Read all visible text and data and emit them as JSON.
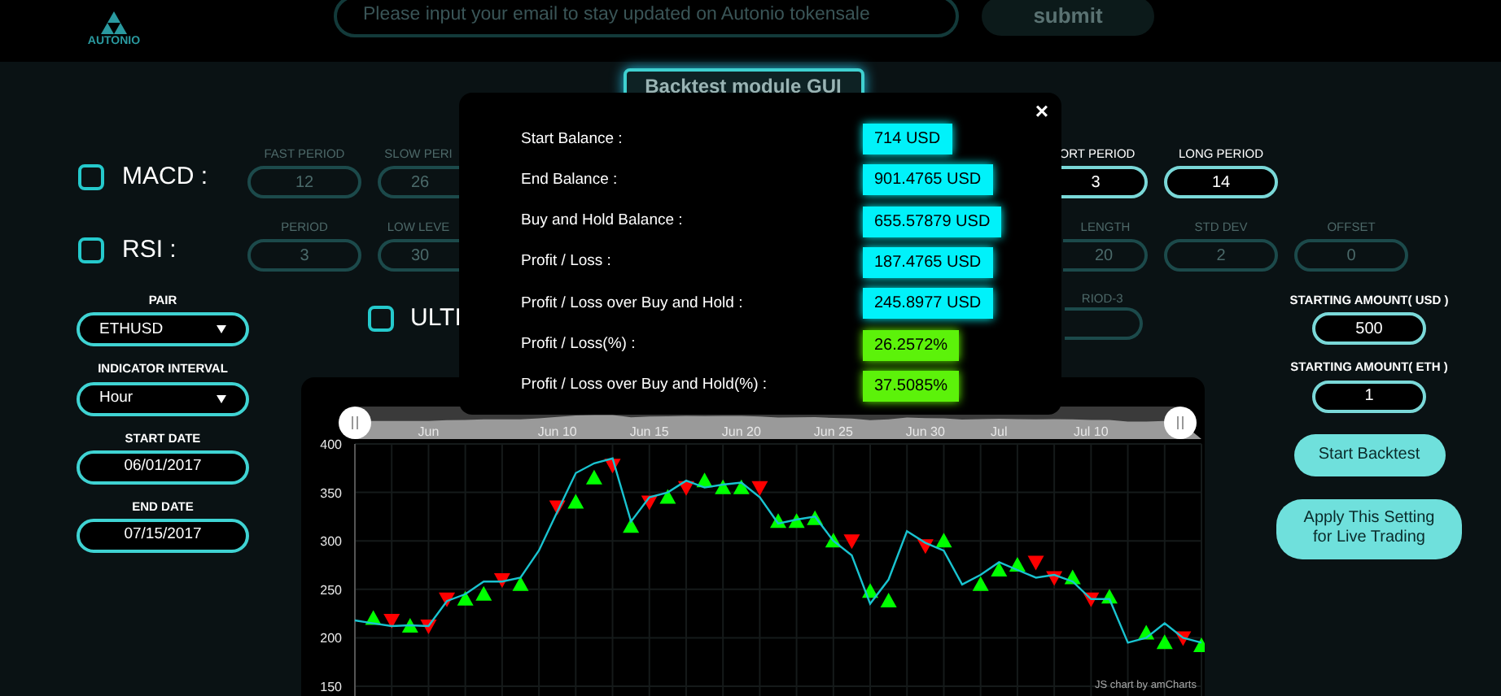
{
  "header": {
    "logo_text": "AUTONIO",
    "email_placeholder": "Please input your email to stay updated on Autonio tokensale",
    "submit_label": "submit"
  },
  "page_button": "Backtest module GUI",
  "indicators": [
    {
      "name": "MACD :",
      "checked": false,
      "fields": [
        {
          "label": "FAST PERIOD",
          "value": "12",
          "disabled": true
        },
        {
          "label": "SLOW PERI",
          "value": "26",
          "disabled": true
        }
      ],
      "right_fields": [
        {
          "label": "ORT PERIOD",
          "value": "3",
          "disabled": false
        },
        {
          "label": "LONG PERIOD",
          "value": "14",
          "disabled": false
        }
      ]
    },
    {
      "name": "RSI :",
      "checked": false,
      "fields": [
        {
          "label": "PERIOD",
          "value": "3",
          "disabled": true
        },
        {
          "label": "LOW LEVE",
          "value": "30",
          "disabled": true
        }
      ],
      "right_fields": [
        {
          "label": "LENGTH",
          "value": "20",
          "disabled": true
        },
        {
          "label": "STD DEV",
          "value": "2",
          "disabled": true
        },
        {
          "label": "OFFSET",
          "value": "0",
          "disabled": true
        }
      ]
    }
  ],
  "ultimate": {
    "name": "ULTI",
    "checked": false,
    "field_label": "RIOD-3"
  },
  "settings": [
    {
      "label": "PAIR",
      "value": "ETHUSD",
      "kind": "select"
    },
    {
      "label": "INDICATOR INTERVAL",
      "value": "Hour",
      "kind": "select"
    },
    {
      "label": "START DATE",
      "value": "06/01/2017",
      "kind": "date"
    },
    {
      "label": "END DATE",
      "value": "07/15/2017",
      "kind": "date"
    }
  ],
  "amounts": [
    {
      "label": "STARTING AMOUNT( USD )",
      "value": "500"
    },
    {
      "label": "STARTING AMOUNT( ETH )",
      "value": "1"
    }
  ],
  "buttons": [
    "Start Backtest",
    "Apply This Setting for Live Trading"
  ],
  "modal": {
    "close": "×",
    "rows": [
      {
        "label": "Start Balance :",
        "value": "714 USD",
        "kind": "amount"
      },
      {
        "label": "End Balance :",
        "value": "901.4765 USD",
        "kind": "amount"
      },
      {
        "label": "Buy and Hold Balance :",
        "value": "655.57879 USD",
        "kind": "amount"
      },
      {
        "label": "Profit / Loss :",
        "value": "187.4765 USD",
        "kind": "amount"
      },
      {
        "label": "Profit / Loss over Buy and Hold :",
        "value": "245.8977 USD",
        "kind": "amount"
      },
      {
        "label": "Profit / Loss(%) :",
        "value": "26.2572%",
        "kind": "percent"
      },
      {
        "label": "Profit / Loss over Buy and Hold(%) :",
        "value": "37.5085%",
        "kind": "percent"
      }
    ]
  },
  "chart": {
    "credit": "JS chart by amCharts",
    "chart_data": {
      "type": "line",
      "grid": true,
      "categories": [
        null,
        null,
        null,
        null,
        "Jun",
        null,
        null,
        null,
        null,
        null,
        null,
        "Jun 10",
        null,
        null,
        null,
        null,
        "Jun 15",
        null,
        null,
        null,
        null,
        "Jun 20",
        null,
        null,
        null,
        null,
        "Jun 25",
        null,
        null,
        null,
        null,
        "Jun 30",
        null,
        null,
        null,
        "Jul",
        null,
        null,
        null,
        null,
        "Jul 10",
        null,
        null,
        null,
        null,
        null,
        null
      ],
      "ylim": [
        150,
        400
      ],
      "yticks": [
        150,
        200,
        250,
        300,
        350,
        400
      ],
      "series": [
        {
          "color": "#19c3d0",
          "values": [
            218,
            215,
            212,
            213,
            212,
            238,
            245,
            258,
            258,
            262,
            290,
            330,
            370,
            380,
            385,
            320,
            345,
            350,
            362,
            355,
            358,
            360,
            345,
            318,
            322,
            325,
            300,
            285,
            235,
            260,
            310,
            298,
            290,
            255,
            265,
            278,
            270,
            262,
            265,
            258,
            240,
            240,
            195,
            200,
            215,
            200,
            195
          ]
        },
        {
          "type": "scatter",
          "color": "#00ff00",
          "values": [
            null,
            220,
            null,
            212,
            null,
            null,
            240,
            245,
            null,
            255,
            null,
            null,
            340,
            365,
            null,
            315,
            null,
            345,
            null,
            362,
            355,
            355,
            null,
            320,
            320,
            323,
            300,
            null,
            248,
            238,
            null,
            null,
            300,
            null,
            255,
            270,
            275,
            null,
            null,
            262,
            null,
            242,
            null,
            205,
            195,
            null,
            192
          ]
        },
        {
          "type": "scatter",
          "color": "#ff0000",
          "values": [
            null,
            null,
            218,
            null,
            212,
            240,
            null,
            null,
            260,
            null,
            null,
            335,
            null,
            null,
            378,
            null,
            340,
            null,
            355,
            null,
            null,
            null,
            355,
            null,
            null,
            null,
            null,
            300,
            null,
            null,
            null,
            295,
            null,
            null,
            null,
            null,
            null,
            278,
            262,
            null,
            240,
            null,
            null,
            null,
            null,
            200,
            null
          ]
        }
      ]
    }
  }
}
